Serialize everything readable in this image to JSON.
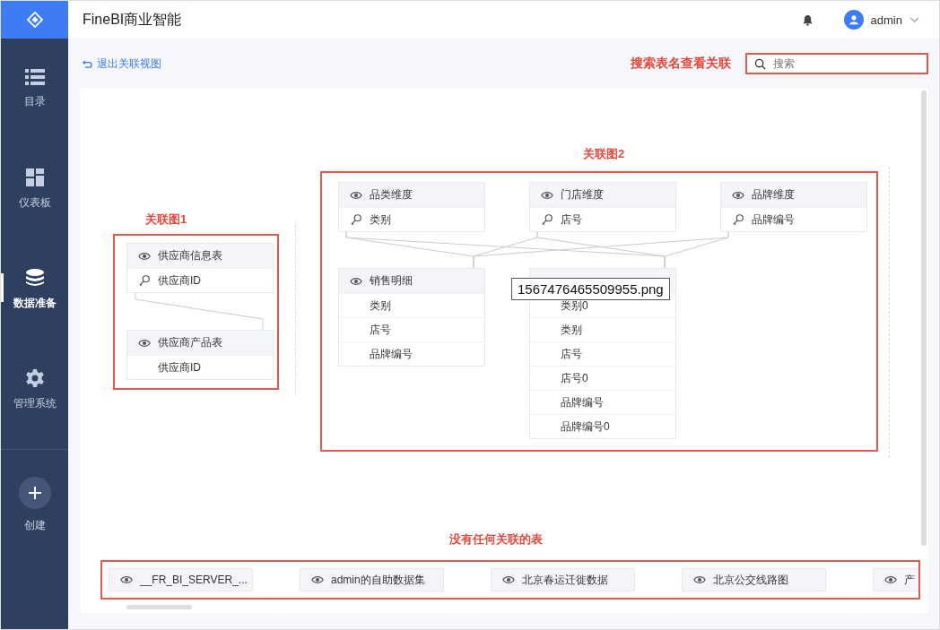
{
  "app": {
    "title": "FineBI商业智能"
  },
  "user": {
    "name": "admin"
  },
  "sidebar": {
    "items": [
      {
        "label": "目录",
        "selected": false
      },
      {
        "label": "仪表板",
        "selected": false
      },
      {
        "label": "数据准备",
        "selected": true
      },
      {
        "label": "管理系统",
        "selected": false
      }
    ],
    "create": "创建"
  },
  "toolbar": {
    "back_link": "退出关联视图",
    "search_annotation": "搜索表名查看关联",
    "search": {
      "placeholder": "搜索"
    }
  },
  "groups": [
    {
      "caption": "关联图1",
      "tables": [
        {
          "name": "供应商信息表",
          "fields": [
            {
              "name": "供应商ID",
              "key": true
            }
          ]
        },
        {
          "name": "供应商产品表",
          "fields": [
            {
              "name": "供应商ID",
              "key": false
            }
          ]
        }
      ]
    },
    {
      "caption": "关联图2",
      "tables": [
        {
          "name": "品类维度",
          "fields": [
            {
              "name": "类别",
              "key": true
            }
          ]
        },
        {
          "name": "门店维度",
          "fields": [
            {
              "name": "店号",
              "key": true
            }
          ]
        },
        {
          "name": "品牌维度",
          "fields": [
            {
              "name": "品牌编号",
              "key": true
            }
          ]
        },
        {
          "name": "销售明细",
          "fields": [
            {
              "name": "类别",
              "key": false
            },
            {
              "name": "店号",
              "key": false
            },
            {
              "name": "品牌编号",
              "key": false
            }
          ]
        },
        {
          "fields": [
            {
              "name": "类别0",
              "key": false
            },
            {
              "name": "类别",
              "key": false
            },
            {
              "name": "店号",
              "key": false
            },
            {
              "name": "店号0",
              "key": false
            },
            {
              "name": "品牌编号",
              "key": false
            },
            {
              "name": "品牌编号0",
              "key": false
            }
          ]
        }
      ]
    }
  ],
  "tooltip": "1567476465509955.png",
  "unlinked": {
    "caption": "没有任何关联的表",
    "tables": [
      "__FR_BI_SERVER_...",
      "admin的自助数据集",
      "北京春运迁徙数据",
      "北京公交线路图",
      "产"
    ]
  }
}
